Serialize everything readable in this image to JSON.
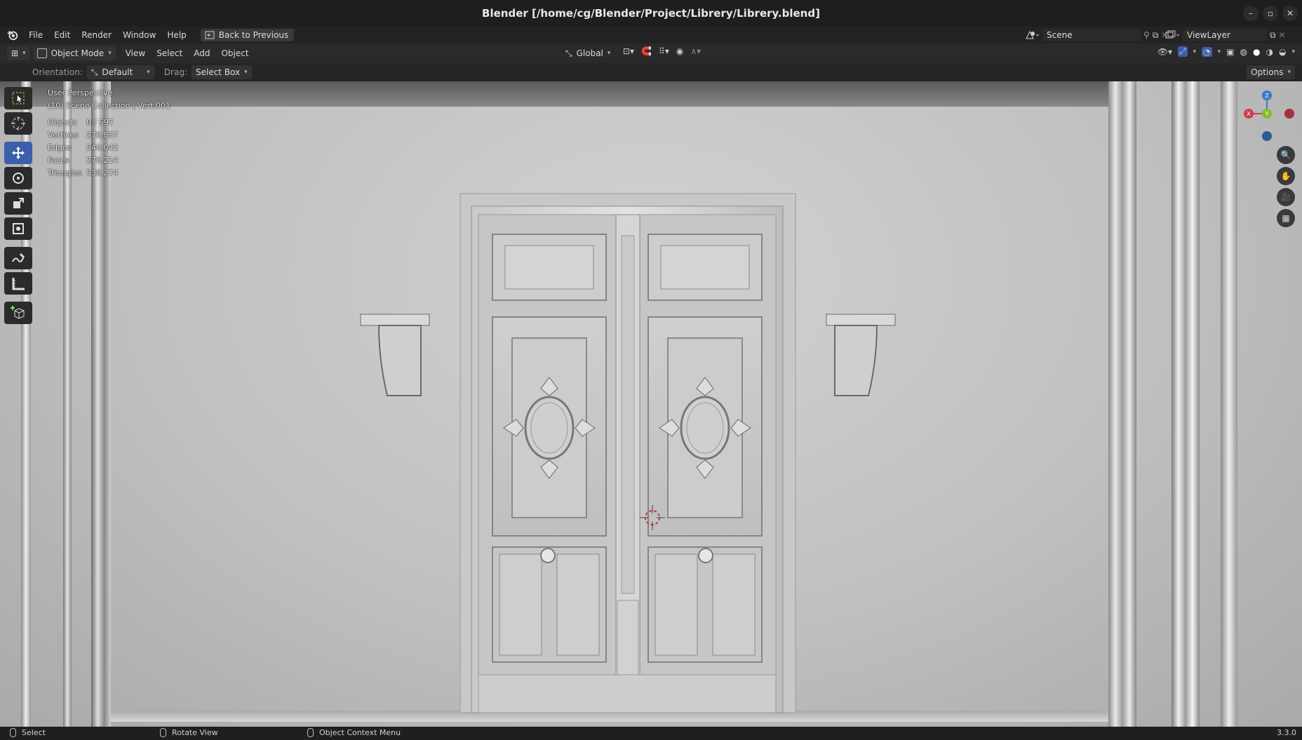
{
  "window": {
    "title": "Blender [/home/cg/Blender/Project/Librery/Librery.blend]",
    "buttons": {
      "minimize": "–",
      "restore": "▫",
      "close": "✕"
    }
  },
  "menubar": {
    "items": [
      "File",
      "Edit",
      "Render",
      "Window",
      "Help"
    ],
    "back_button": "Back to Previous",
    "scene": "Scene",
    "view_layer": "ViewLayer"
  },
  "header": {
    "mode": "Object Mode",
    "menus": [
      "View",
      "Select",
      "Add",
      "Object"
    ],
    "transform_orientation": "Global"
  },
  "tool_header": {
    "orientation_label": "Orientation:",
    "orientation_value": "Default",
    "drag_label": "Drag:",
    "drag_value": "Select Box",
    "options": "Options"
  },
  "viewport": {
    "perspective": "User Perspective",
    "collection": "(10) Scene Collection | Vert.001",
    "stats": [
      {
        "key": "Objects",
        "value": "0 / 597"
      },
      {
        "key": "Vertices",
        "value": "270,857"
      },
      {
        "key": "Edges",
        "value": "540,042"
      },
      {
        "key": "Faces",
        "value": "270,214"
      },
      {
        "key": "Triangles",
        "value": "538,274"
      }
    ]
  },
  "gizmo": {
    "x": "X",
    "y": "Y",
    "z": "Z"
  },
  "statusbar": {
    "select": "Select",
    "rotate": "Rotate View",
    "context": "Object Context Menu",
    "version": "3.3.0"
  },
  "colors": {
    "accent": "#3b5fa8",
    "axis_x": "#d23c4c",
    "axis_y": "#7fbf2a",
    "axis_z": "#3a78c9"
  }
}
